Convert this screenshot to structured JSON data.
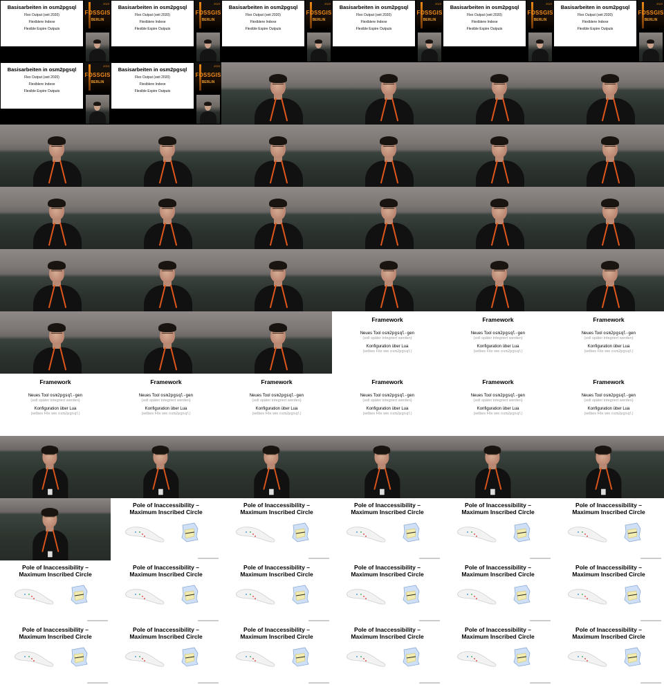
{
  "layout": {
    "columns": 6,
    "rows": 11
  },
  "slides": {
    "basis": {
      "title": "Basisarbeiten in osm2pgsql",
      "lines": [
        "Flex Output (seit 2020)",
        "Flexiblere Indexe",
        "Flexible Expire Outputs"
      ],
      "logo": {
        "name": "FOSSGIS",
        "city": "BERLIN",
        "year": "2023"
      }
    },
    "framework": {
      "title": "Framework",
      "line1_prefix": "Neues Tool ",
      "line1_code": "osm2pgsql-gen",
      "line1_sub": "(soll später integriert werden)",
      "line2": "Konfiguration über Lua",
      "line2_sub_prefix": "(selbes File wie ",
      "line2_sub_code": "osm2pgsql",
      "line2_sub_suffix": ")"
    },
    "pole": {
      "title_line1": "Pole of Inaccessibility –",
      "title_line2": "Maximum Inscribed Circle"
    }
  },
  "colors": {
    "logo_orange": "#f08a18",
    "lanyard": "#e1561a",
    "slide_bg": "#ffffff",
    "letterbox": "#000000"
  },
  "tiles": [
    "basis",
    "basis",
    "basis",
    "basis",
    "basis",
    "basis",
    "basis",
    "basis",
    "cam",
    "cam",
    "cam",
    "cam",
    "cam",
    "cam",
    "cam",
    "cam",
    "cam",
    "cam",
    "cam",
    "cam",
    "cam",
    "cam",
    "cam",
    "cam",
    "cam",
    "cam",
    "cam",
    "cam",
    "cam",
    "cam",
    "cam",
    "cam",
    "cam",
    "framework",
    "framework",
    "framework",
    "framework",
    "framework",
    "framework",
    "framework",
    "framework",
    "framework",
    "wide",
    "wide",
    "wide",
    "wide",
    "wide",
    "wide",
    "wide",
    "pole",
    "pole",
    "pole",
    "pole",
    "pole",
    "pole",
    "pole",
    "pole",
    "pole",
    "pole",
    "pole",
    "pole",
    "pole",
    "pole",
    "pole",
    "pole",
    "pole"
  ]
}
